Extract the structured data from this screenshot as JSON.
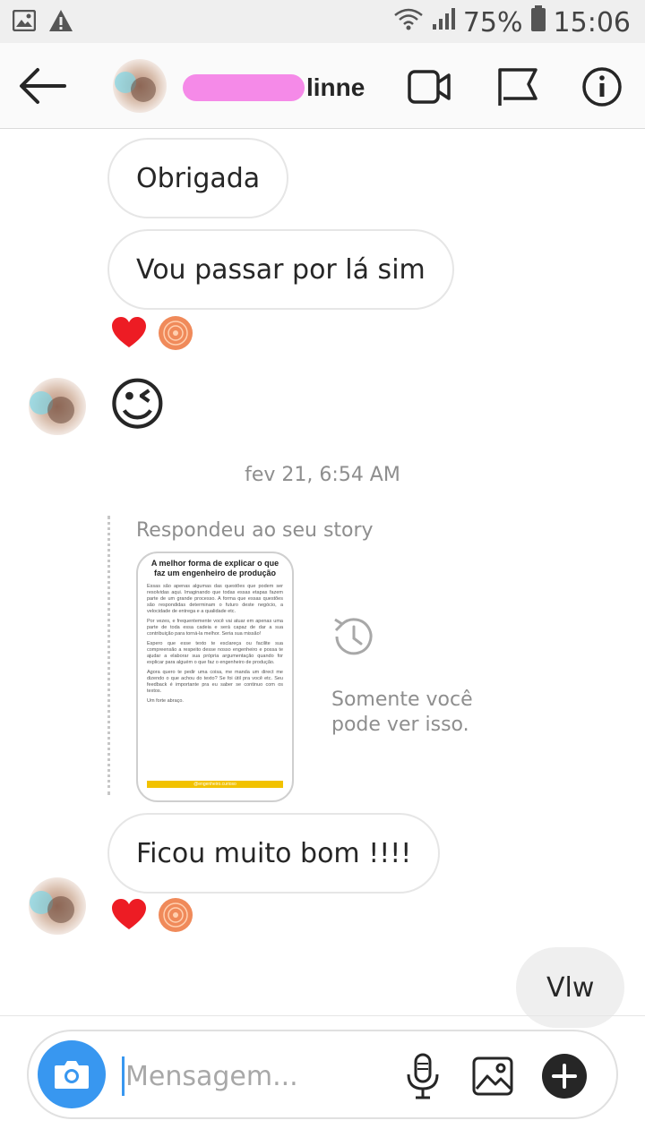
{
  "status_bar": {
    "battery": "75%",
    "time": "15:06",
    "icons": [
      "image-icon",
      "warning-icon",
      "wifi-icon",
      "signal-icon",
      "battery-icon"
    ]
  },
  "header": {
    "username_suffix": "linne",
    "icons": [
      "back-arrow-icon",
      "video-call-icon",
      "flag-icon",
      "info-icon"
    ]
  },
  "messages": {
    "m1": "Obrigada",
    "m2": "Vou passar por lá sim",
    "m3_emoji": "😉",
    "timestamp": "fev 21, 6:54 AM",
    "story_label": "Respondeu ao seu story",
    "story_card": {
      "title": "A melhor forma de explicar o que faz um engenheiro de produção",
      "p1": "Essas são apenas algumas das questões que podem ser resolvidas aqui. Imaginando que todas essas etapas fazem parte de um grande processo. A forma que essas questões são respondidas determinam o futuro deste negócio, a velocidade de entrega e a qualidade etc.",
      "p2": "Por vezes, e frequentemente você vai atuar em apenas uma parte de toda essa cadeia e será capaz de dar a sua contribuição para torná-la melhor. Seria sua missão!",
      "p3": "Espero que esse texto te esclareça ou facilite sua compreensão a respeito desse nosso engenheiro e possa te ajudar a elaborar sua própria argumentação quando for explicar para alguém o que faz o engenheiro de produção.",
      "p4": "Agora quero te pedir uma coisa, me manda um direct me dizendo o que achou do texto? Se foi útil pra você etc. Seu feedback é importante pra eu saber se continuo com os textos.",
      "p5": "Um forte abraço.",
      "footer": "@engenheiro.curioso"
    },
    "private_text": "Somente você pode ver isso.",
    "m4": "Ficou muito bom !!!!",
    "own1": "Vlw"
  },
  "composer": {
    "placeholder": "Mensagem...",
    "icons": [
      "camera-icon",
      "microphone-icon",
      "gallery-icon",
      "add-icon"
    ]
  },
  "colors": {
    "accent_blue": "#3897f0",
    "heart_red": "#ed1c24",
    "name_blur_pink": "#f58ae8",
    "bubble_border": "#e6e6e6",
    "meta_gray": "#8e8e8e"
  }
}
